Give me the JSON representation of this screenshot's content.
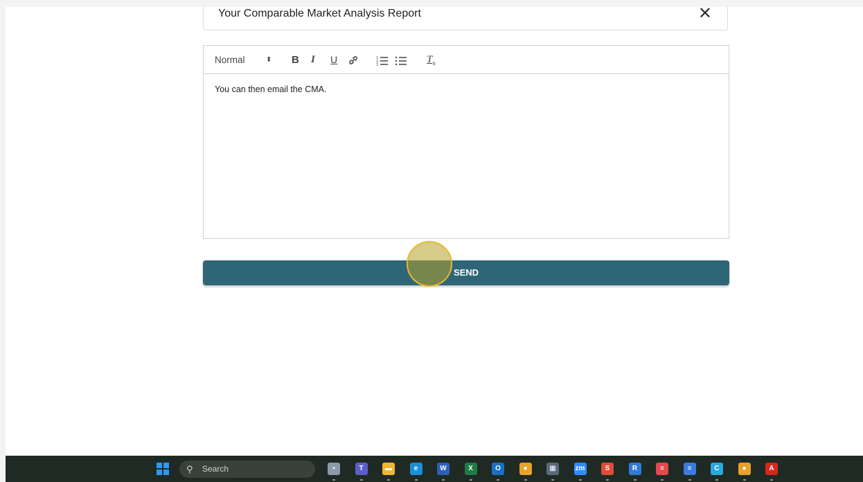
{
  "email": {
    "subject": "Your Comparable Market Analysis Report",
    "close_label": "✕"
  },
  "editor": {
    "toolbar": {
      "style_select": "Normal",
      "style_arrows": "⬍",
      "bold": "B",
      "italic": "I",
      "underline": "U",
      "link_icon": "link-icon",
      "ordered_list_icon": "ordered-list-icon",
      "bullet_list_icon": "bullet-list-icon",
      "clear_format": "T"
    },
    "body": "You can then email the CMA."
  },
  "send_button": {
    "label": "SEND"
  },
  "taskbar": {
    "search_label": "Search",
    "apps": [
      {
        "name": "task-view",
        "color": "#8a9aa8",
        "glyph": "▪"
      },
      {
        "name": "teams",
        "color": "#5b5fc7",
        "glyph": "T"
      },
      {
        "name": "file-explorer",
        "color": "#f2b82a",
        "glyph": "▬"
      },
      {
        "name": "edge",
        "color": "#1b8fd8",
        "glyph": "e"
      },
      {
        "name": "word",
        "color": "#2b5fb8",
        "glyph": "W"
      },
      {
        "name": "excel",
        "color": "#1e7b45",
        "glyph": "X"
      },
      {
        "name": "outlook",
        "color": "#1a6fc2",
        "glyph": "O"
      },
      {
        "name": "chrome",
        "color": "#e8a22a",
        "glyph": "●"
      },
      {
        "name": "calculator",
        "color": "#5a6a7a",
        "glyph": "▦"
      },
      {
        "name": "zoom",
        "color": "#2d8cff",
        "glyph": "zm"
      },
      {
        "name": "s-app",
        "color": "#e14b3a",
        "glyph": "S"
      },
      {
        "name": "r-app",
        "color": "#2f7ad6",
        "glyph": "R"
      },
      {
        "name": "red-app",
        "color": "#e5484d",
        "glyph": "≡"
      },
      {
        "name": "docs",
        "color": "#3a7be0",
        "glyph": "≡"
      },
      {
        "name": "c-app",
        "color": "#2aa8e0",
        "glyph": "C"
      },
      {
        "name": "chrome-2",
        "color": "#e8a22a",
        "glyph": "●"
      },
      {
        "name": "acrobat",
        "color": "#d9261c",
        "glyph": "A"
      }
    ]
  }
}
